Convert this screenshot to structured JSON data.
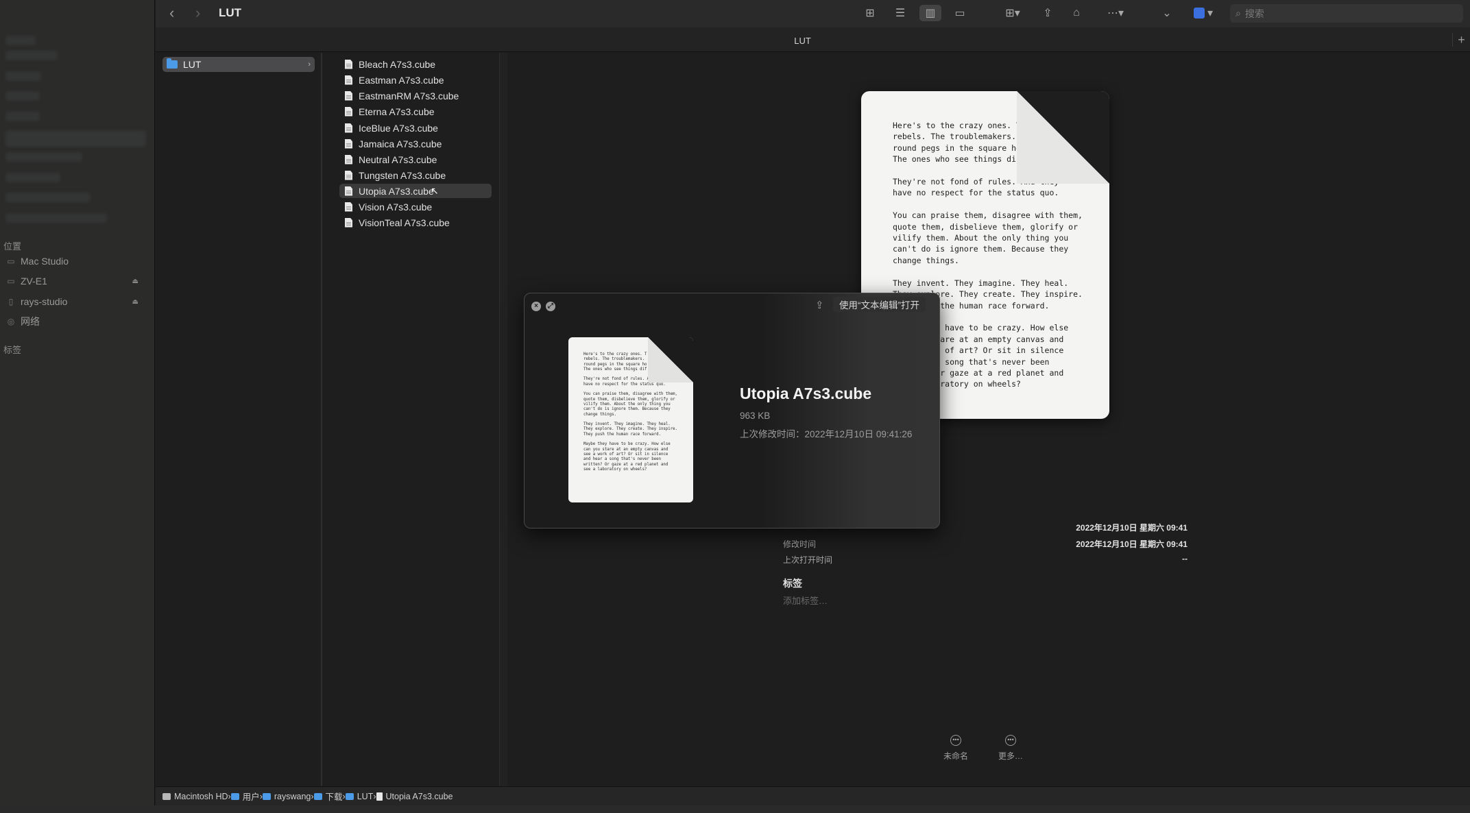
{
  "window": {
    "title": "LUT",
    "tab_title": "LUT"
  },
  "sidebar": {
    "sections": {
      "locations": "位置",
      "tags": "标签"
    },
    "locations": [
      {
        "label": "Mac Studio",
        "icon": "computer-icon"
      },
      {
        "label": "ZV-E1",
        "icon": "drive-icon",
        "eject": true
      },
      {
        "label": "rays-studio",
        "icon": "disk-icon",
        "eject": true
      },
      {
        "label": "网络",
        "icon": "network-icon"
      }
    ]
  },
  "toolbar": {
    "search_placeholder": "搜索"
  },
  "columns": {
    "col1": {
      "folder": "LUT"
    },
    "files": [
      "Bleach A7s3.cube",
      "Eastman A7s3.cube",
      "EastmanRM A7s3.cube",
      "Eterna A7s3.cube",
      "IceBlue A7s3.cube",
      "Jamaica A7s3.cube",
      "Neutral A7s3.cube",
      "Tungsten A7s3.cube",
      "Utopia A7s3.cube",
      "Vision A7s3.cube",
      "VisionTeal A7s3.cube"
    ],
    "selected_index": 8
  },
  "preview": {
    "doc_text": "Here's to the crazy ones. T\nrebels. The troublemakers.\nround pegs in the square ho\nThe ones who see things dif\n\nThey're not fond of rules. And they\nhave no respect for the status quo.\n\nYou can praise them, disagree with them,\nquote them, disbelieve them, glorify or\nvilify them. About the only thing you\ncan't do is ignore them. Because they\nchange things.\n\nThey invent. They imagine. They heal.\nThey explore. They create. They inspire.\nThey push the human race forward.\n\nMaybe they have to be crazy. How else\ncan you stare at an empty canvas and\nsee a work of art? Or sit in silence\nand hear a song that's never been\nwritten? Or gaze at a red planet and\nsee a laboratory on wheels?",
    "meta": [
      {
        "label": "",
        "value": "2022年12月10日 星期六 09:41"
      },
      {
        "label": "修改时间",
        "value": "2022年12月10日 星期六 09:41"
      },
      {
        "label": "上次打开时间",
        "value": "--"
      }
    ],
    "tags_title": "标签",
    "tags_placeholder": "添加标签…",
    "actions": [
      {
        "label": "未命名"
      },
      {
        "label": "更多…"
      }
    ]
  },
  "quicklook": {
    "open_with": "使用“文本编辑”打开",
    "name": "Utopia A7s3.cube",
    "size": "963 KB",
    "modified": "上次修改时间：2022年12月10日 09:41:26"
  },
  "pathbar": [
    {
      "label": "Macintosh HD",
      "icon": "hd"
    },
    {
      "label": "用户",
      "icon": "folder"
    },
    {
      "label": "rayswang",
      "icon": "folder"
    },
    {
      "label": "下载",
      "icon": "folder"
    },
    {
      "label": "LUT",
      "icon": "folder"
    },
    {
      "label": "Utopia A7s3.cube",
      "icon": "doc"
    }
  ]
}
